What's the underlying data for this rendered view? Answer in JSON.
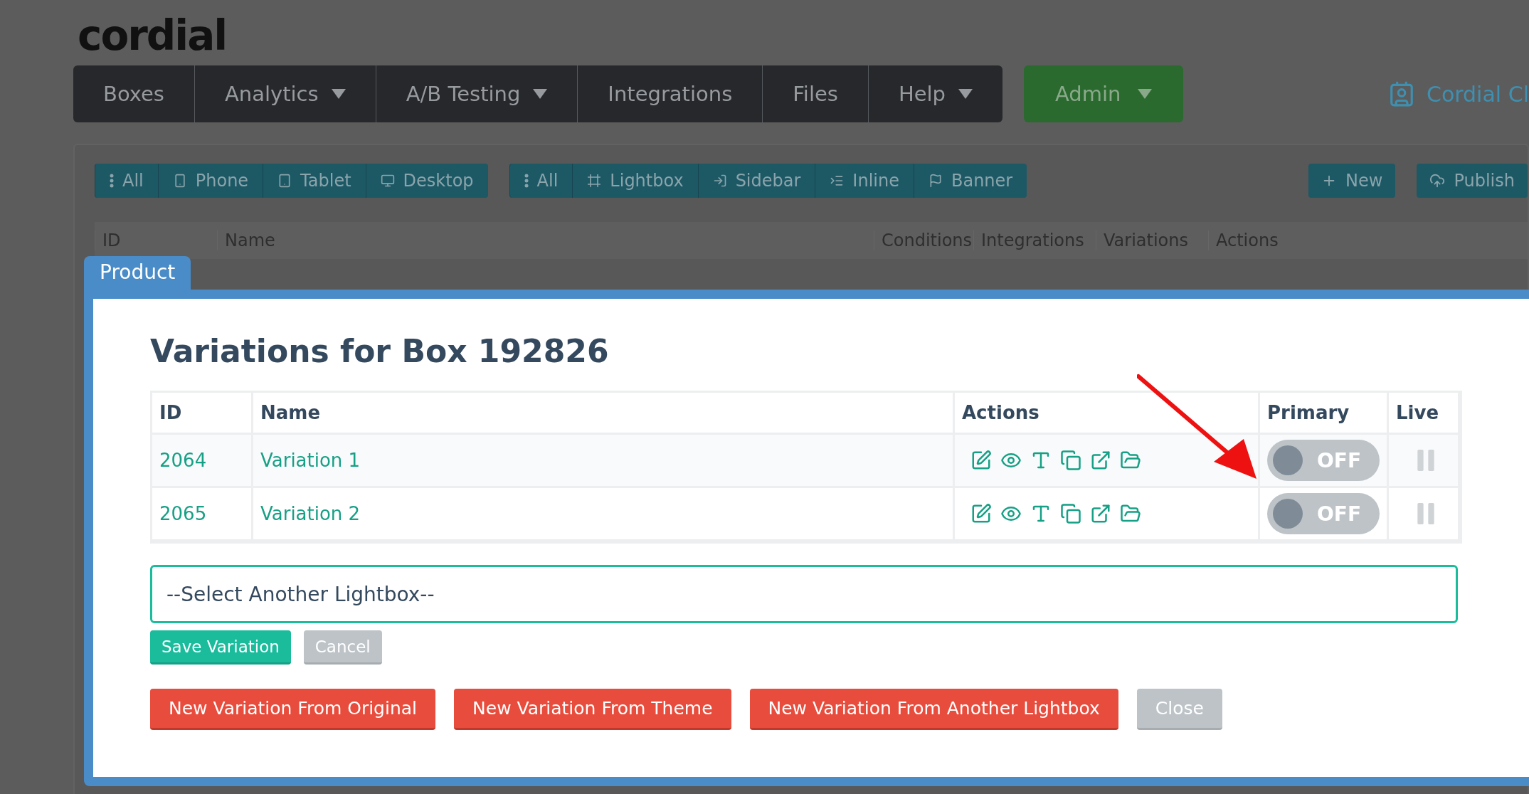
{
  "logo": "cordial",
  "nav": [
    {
      "label": "Boxes",
      "dropdown": false
    },
    {
      "label": "Analytics",
      "dropdown": true
    },
    {
      "label": "A/B Testing",
      "dropdown": true
    },
    {
      "label": "Integrations",
      "dropdown": false
    },
    {
      "label": "Files",
      "dropdown": false
    },
    {
      "label": "Help",
      "dropdown": true
    }
  ],
  "admin": {
    "label": "Admin",
    "dropdown": true
  },
  "account": {
    "label": "Cordial Cl"
  },
  "device_filters": [
    {
      "label": "All"
    },
    {
      "label": "Phone"
    },
    {
      "label": "Tablet"
    },
    {
      "label": "Desktop"
    }
  ],
  "type_filters": [
    {
      "label": "All"
    },
    {
      "label": "Lightbox"
    },
    {
      "label": "Sidebar"
    },
    {
      "label": "Inline"
    },
    {
      "label": "Banner"
    }
  ],
  "page_actions": [
    {
      "label": "New"
    },
    {
      "label": "Publish"
    }
  ],
  "boxes_table": {
    "columns": [
      "ID",
      "Name",
      "Conditions",
      "Integrations",
      "Variations",
      "Actions"
    ]
  },
  "modal": {
    "tab": "Product",
    "title": "Variations for Box 192826",
    "columns": [
      "ID",
      "Name",
      "Actions",
      "Primary",
      "Live"
    ],
    "rows": [
      {
        "id": "2064",
        "name": "Variation 1",
        "primary": {
          "on": false,
          "label": "OFF"
        },
        "live": false
      },
      {
        "id": "2065",
        "name": "Variation 2",
        "primary": {
          "on": false,
          "label": "OFF"
        },
        "live": false
      }
    ],
    "select": {
      "value": "--Select Another Lightbox--"
    },
    "form_buttons": [
      {
        "label": "Save Variation",
        "kind": "primary"
      },
      {
        "label": "Cancel",
        "kind": "default"
      }
    ],
    "buttons": [
      {
        "label": "New Variation From Original",
        "kind": "danger"
      },
      {
        "label": "New Variation From Theme",
        "kind": "danger"
      },
      {
        "label": "New Variation From Another Lightbox",
        "kind": "danger"
      },
      {
        "label": "Close",
        "kind": "default"
      }
    ]
  }
}
